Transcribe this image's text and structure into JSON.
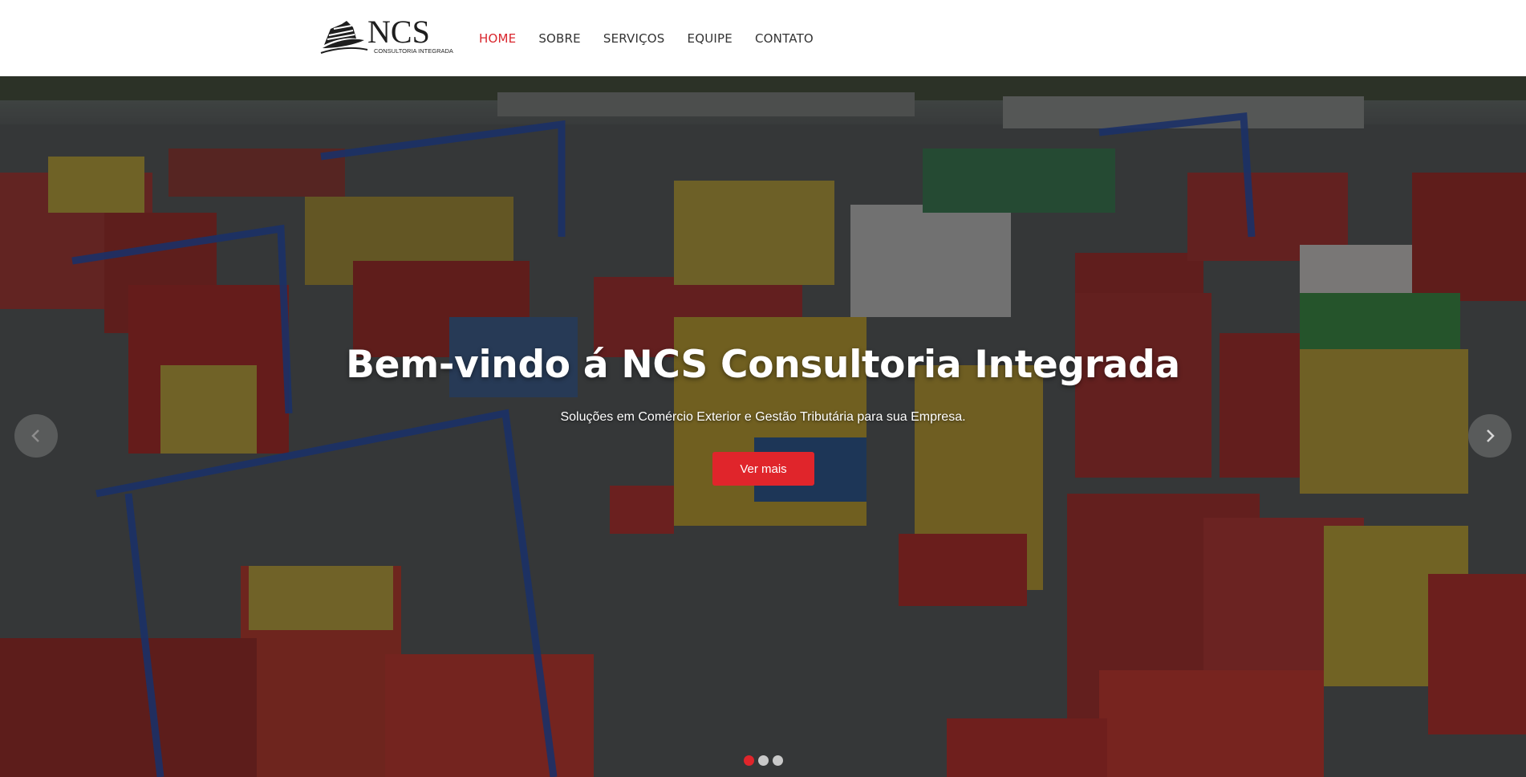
{
  "brand": {
    "logo_text": "NCS",
    "logo_subtitle": "CONSULTORIA INTEGRADA"
  },
  "nav": {
    "items": [
      {
        "label": "HOME",
        "active": true
      },
      {
        "label": "SOBRE",
        "active": false
      },
      {
        "label": "SERVIÇOS",
        "active": false
      },
      {
        "label": "EQUIPE",
        "active": false
      },
      {
        "label": "CONTATO",
        "active": false
      }
    ]
  },
  "hero": {
    "title": "Bem-vindo á NCS Consultoria Integrada",
    "subtitle": "Soluções em Comércio Exterior e Gestão Tributária para sua Empresa.",
    "button_label": "Ver mais",
    "background": "container-port-aerial-photo",
    "slides": 3,
    "active_slide": 1
  },
  "icons": {
    "prev": "chevron-left-icon",
    "next": "chevron-right-icon"
  },
  "colors": {
    "accent": "#e0252b",
    "nav_active": "#d9262d",
    "nav_text": "#333333",
    "header_bg": "#ffffff"
  }
}
